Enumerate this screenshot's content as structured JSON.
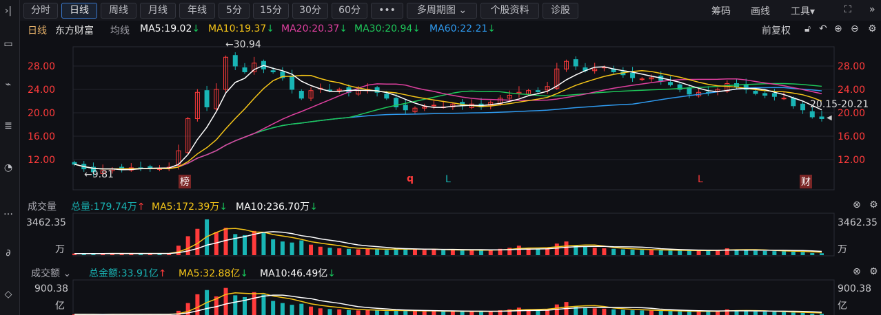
{
  "toolbar": {
    "tabs": [
      "分时",
      "日线",
      "周线",
      "月线",
      "年线",
      "5分",
      "15分",
      "30分",
      "60分",
      "•••",
      "多周期图 ⌄",
      "个股资料",
      "诊股"
    ],
    "active": "日线",
    "right": [
      "筹码",
      "画线",
      "工具▾"
    ]
  },
  "legend": {
    "period": "日线",
    "stock": "东方财富",
    "ma_label": "均线",
    "ma5": "MA5:19.02",
    "ma10": "MA10:19.37",
    "ma20": "MA20:20.37",
    "ma30": "MA30:20.94",
    "ma60": "MA60:22.21",
    "down_arrow": "↓",
    "up_arrow": "↑",
    "adjust": "前复权"
  },
  "colors": {
    "ma5": "#ffffff",
    "ma10": "#f5c518",
    "ma20": "#e040a0",
    "ma30": "#1ec85a",
    "ma60": "#2f9bf0",
    "up": "#ff3b3b",
    "down": "#19b5b5",
    "axis": "#ff3b3b"
  },
  "annotations": {
    "high": "←30.94",
    "low": "←9.81",
    "range": "20.15-20.21",
    "badge_bang": "榜",
    "badge_cai": "财",
    "mark_q": "q",
    "mark_l1": "L",
    "mark_l2": "L"
  },
  "volume": {
    "title": "成交量",
    "total": "总量:179.74万",
    "ma5": "MA5:172.39万",
    "ma10": "MA10:236.70万",
    "max_label": "3462.35",
    "unit": "万"
  },
  "amount": {
    "title": "成交额 ⌄",
    "total": "总金额:33.91亿",
    "ma5": "MA5:32.88亿",
    "ma10": "MA10:46.49亿",
    "max_label": "900.38",
    "unit": "亿"
  },
  "chart_data": {
    "type": "candlestick",
    "price_ticks": [
      "28.00",
      "24.00",
      "20.00",
      "16.00",
      "12.00"
    ],
    "ylim": [
      9,
      31
    ],
    "close": [
      11.2,
      10.4,
      9.9,
      10.1,
      10.4,
      10.5,
      10.6,
      10.5,
      10.6,
      10.5,
      10.7,
      13.5,
      19,
      23.5,
      21,
      24,
      29.5,
      28,
      27,
      28.5,
      27.5,
      27,
      26,
      24,
      22.5,
      23.8,
      24.2,
      23.8,
      24,
      23.5,
      23.8,
      24,
      23.5,
      22.5,
      21,
      20.5,
      20.8,
      21,
      21.3,
      21,
      21.5,
      21.2,
      21.5,
      21,
      21.8,
      22.5,
      23,
      23.5,
      23.8,
      23.6,
      24.5,
      27.5,
      28.8,
      28,
      27.2,
      27.5,
      27.8,
      27,
      26.5,
      26,
      25.8,
      26,
      25.5,
      24.8,
      24,
      23.2,
      23.5,
      23.4,
      24,
      25,
      24.5,
      24,
      23.3,
      23,
      22.8,
      22.5,
      21.2,
      20.5,
      19.3,
      19.0
    ],
    "volume_wan": [
      150,
      140,
      160,
      150,
      170,
      150,
      160,
      150,
      140,
      160,
      200,
      900,
      1800,
      2500,
      3400,
      2200,
      2600,
      2000,
      1900,
      2300,
      2100,
      1500,
      1300,
      1200,
      1400,
      1000,
      800,
      700,
      650,
      600,
      550,
      600,
      550,
      500,
      650,
      600,
      550,
      500,
      520,
      480,
      500,
      460,
      480,
      450,
      520,
      600,
      700,
      900,
      650,
      600,
      700,
      1100,
      1300,
      900,
      800,
      700,
      650,
      600,
      550,
      520,
      500,
      480,
      460,
      450,
      430,
      420,
      440,
      450,
      500,
      650,
      550,
      480,
      420,
      400,
      380,
      360,
      340,
      300,
      200,
      180
    ],
    "amount_yi": [
      17,
      15,
      16,
      15,
      18,
      16,
      17,
      16,
      15,
      17,
      21,
      120,
      340,
      590,
      710,
      530,
      770,
      560,
      510,
      650,
      580,
      400,
      340,
      290,
      320,
      240,
      190,
      170,
      160,
      140,
      130,
      140,
      130,
      110,
      140,
      120,
      115,
      105,
      110,
      100,
      108,
      98,
      103,
      95,
      113,
      135,
      160,
      210,
      155,
      140,
      170,
      300,
      370,
      250,
      220,
      190,
      180,
      160,
      145,
      135,
      130,
      125,
      117,
      112,
      103,
      97,
      103,
      105,
      120,
      160,
      135,
      115,
      98,
      92,
      87,
      81,
      72,
      62,
      39,
      34
    ],
    "volume_max": 3462.35,
    "amount_max": 900.38
  }
}
